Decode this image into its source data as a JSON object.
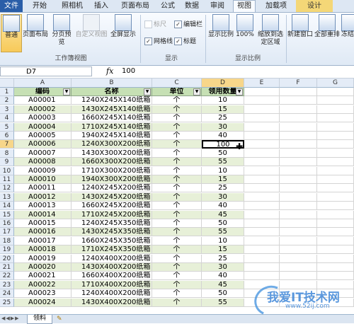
{
  "ribbon_tabs": [
    "文件",
    "开始",
    "照相机",
    "插入",
    "页面布局",
    "公式",
    "数据",
    "审阅",
    "视图",
    "加载项",
    "设计"
  ],
  "active_tab": "视图",
  "ribbon": {
    "workbook_views": {
      "normal": "普通",
      "page_layout": "页面布局",
      "page_break_preview": "分页预览",
      "custom_views": "自定义视图",
      "full_screen": "全屏显示"
    },
    "workbook_views_group": "工作簿视图",
    "show": {
      "ruler": "标尺",
      "gridlines": "网格线",
      "formula_bar": "编辑栏",
      "headings": "标题"
    },
    "show_group": "显示",
    "zoom": {
      "zoom": "显示比例",
      "hundred": "100%",
      "zoom_to_selection": "缩放到选定区域"
    },
    "zoom_group": "显示比例",
    "window": {
      "new_window": "新建窗口",
      "arrange_all": "全部重排",
      "freeze": "冻结"
    }
  },
  "formula_bar": {
    "name_box": "D7",
    "fx": "fx",
    "value": "100"
  },
  "columns": [
    "A",
    "B",
    "C",
    "D",
    "E",
    "F",
    "G"
  ],
  "selected_column": "D",
  "selected_row": 7,
  "table": {
    "headers": [
      "编码",
      "名称",
      "单位",
      "领用数量"
    ],
    "rows": [
      [
        "A00001",
        "1240X245X140纸箱",
        "个",
        "10"
      ],
      [
        "A00002",
        "1430X245X140纸箱",
        "个",
        "15"
      ],
      [
        "A00003",
        "1660X245X140纸箱",
        "个",
        "25"
      ],
      [
        "A00004",
        "1710X245X140纸箱",
        "个",
        "30"
      ],
      [
        "A00005",
        "1940X245X140纸箱",
        "个",
        "40"
      ],
      [
        "A00006",
        "1240X300X200纸箱",
        "个",
        "100"
      ],
      [
        "A00007",
        "1430X300X200纸箱",
        "个",
        "50"
      ],
      [
        "A00008",
        "1660X300X200纸箱",
        "个",
        "55"
      ],
      [
        "A00009",
        "1710X300X200纸箱",
        "个",
        "10"
      ],
      [
        "A00010",
        "1940X300X200纸箱",
        "个",
        "15"
      ],
      [
        "A00011",
        "1240X245X200纸箱",
        "个",
        "25"
      ],
      [
        "A00012",
        "1430X245X200纸箱",
        "个",
        "30"
      ],
      [
        "A00013",
        "1660X245X200纸箱",
        "个",
        "40"
      ],
      [
        "A00014",
        "1710X245X200纸箱",
        "个",
        "45"
      ],
      [
        "A00015",
        "1240X245X350纸箱",
        "个",
        "50"
      ],
      [
        "A00016",
        "1430X245X350纸箱",
        "个",
        "55"
      ],
      [
        "A00017",
        "1660X245X350纸箱",
        "个",
        "10"
      ],
      [
        "A00018",
        "1710X245X350纸箱",
        "个",
        "15"
      ],
      [
        "A00019",
        "1240X400X200纸箱",
        "个",
        "25"
      ],
      [
        "A00020",
        "1430X400X200纸箱",
        "个",
        "30"
      ],
      [
        "A00021",
        "1660X400X200纸箱",
        "个",
        "40"
      ],
      [
        "A00022",
        "1710X400X200纸箱",
        "个",
        "45"
      ],
      [
        "A00023",
        "1240X400X200纸箱",
        "个",
        "50"
      ],
      [
        "A00024",
        "1430X400X200纸箱",
        "个",
        "55"
      ]
    ]
  },
  "sheet_tab": "领料",
  "watermark": {
    "text": "我爱IT技术网",
    "url": "www.52ij.com"
  }
}
